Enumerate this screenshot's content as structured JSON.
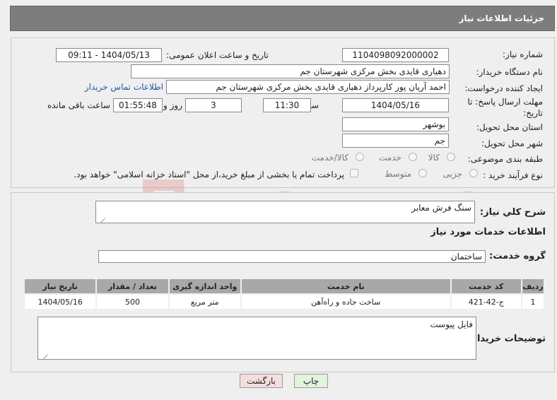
{
  "header": {
    "title": "جزئیات اطلاعات نیاز"
  },
  "form": {
    "need_number_label": "شماره نیاز:",
    "need_number": "1104098092000002",
    "announce_label": "تاریخ و ساعت اعلان عمومی:",
    "announce_value": "1404/05/13 - 09:11",
    "buyer_org_label": "نام دستگاه خریدار:",
    "buyer_org": "دهیاری قایدی بخش مرکزی شهرستان جم",
    "creator_label": "ایجاد کننده درخواست:",
    "creator": "احمد آریان پور کارپرداز دهیاری قایدی بخش مرکزی شهرستان جم",
    "contact_link": "اطلاعات تماس خریدار",
    "deadline_label": "مهلت ارسال پاسخ: تا تاریخ:",
    "deadline_date": "1404/05/16",
    "time_label": "ساعت",
    "deadline_time": "11:30",
    "days_value": "3",
    "days_label": "روز و",
    "remaining_time": "01:55:48",
    "remaining_label": "ساعت باقی مانده",
    "province_label": "استان محل تحویل:",
    "province": "بوشهر",
    "city_label": "شهر محل تحویل:",
    "city": "جم",
    "category_label": "طبقه بندی موضوعی:",
    "category_options": [
      "کالا",
      "خدمت",
      "کالا/خدمت"
    ],
    "purchase_label": "نوع فرآیند خرید :",
    "purchase_options": [
      "جزیی",
      "متوسط"
    ],
    "payment_note": "پرداخت تمام یا بخشی از مبلغ خرید،از محل \"اسناد خزانه اسلامی\" خواهد بود."
  },
  "summary": {
    "label": "شرح کلي نياز:",
    "value": "سنگ فرش معابر",
    "services_title": "اطلاعات خدمات مورد نياز",
    "group_label": "گروه خدمت:",
    "group_value": "ساختمان"
  },
  "table": {
    "headers": [
      "ردیف",
      "کد خدمت",
      "نام خدمت",
      "واحد اندازه گیری",
      "تعداد / مقدار",
      "تاریخ نیاز"
    ],
    "rows": [
      [
        "1",
        "ج-42-421",
        "ساخت جاده و راه‌آهن",
        "متر مربع",
        "500",
        "1404/05/16"
      ]
    ]
  },
  "notes": {
    "label": "توضیحات خریدار:",
    "value": "فایل پیوست"
  },
  "buttons": {
    "print": "چاپ",
    "back": "بازگشت"
  },
  "watermark": {
    "text": "AriaTender.net"
  },
  "colors": {
    "header_bg": "#7d7d7d",
    "table_header_bg": "#a8a8a8",
    "back_btn_bg": "#f7dede",
    "print_btn_bg": "#e2f4dc"
  }
}
